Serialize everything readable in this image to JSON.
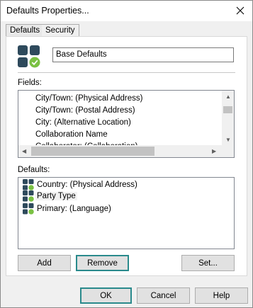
{
  "window": {
    "title": "Defaults Properties..."
  },
  "tabs": [
    {
      "label": "Defaults",
      "active": true
    },
    {
      "label": "Security",
      "active": false
    }
  ],
  "name_field": {
    "value": "Base Defaults"
  },
  "fields": {
    "label": "Fields:",
    "items": [
      "City/Town: (Physical Address)",
      "City/Town: (Postal Address)",
      "City: (Alternative Location)",
      "Collaboration Name",
      "Collaborator: (Collaboration)"
    ]
  },
  "defaults": {
    "label": "Defaults:",
    "items": [
      {
        "label": "Country: (Physical Address)",
        "selected": false
      },
      {
        "label": "Party Type",
        "selected": true
      },
      {
        "label": "Primary: (Language)",
        "selected": false
      }
    ]
  },
  "buttons": {
    "add": "Add",
    "remove": "Remove",
    "set": "Set...",
    "ok": "OK",
    "cancel": "Cancel",
    "help": "Help"
  },
  "colors": {
    "icon_dark": "#2e4a5c",
    "icon_check": "#7ac143",
    "focus_border": "#2a8a8c"
  }
}
